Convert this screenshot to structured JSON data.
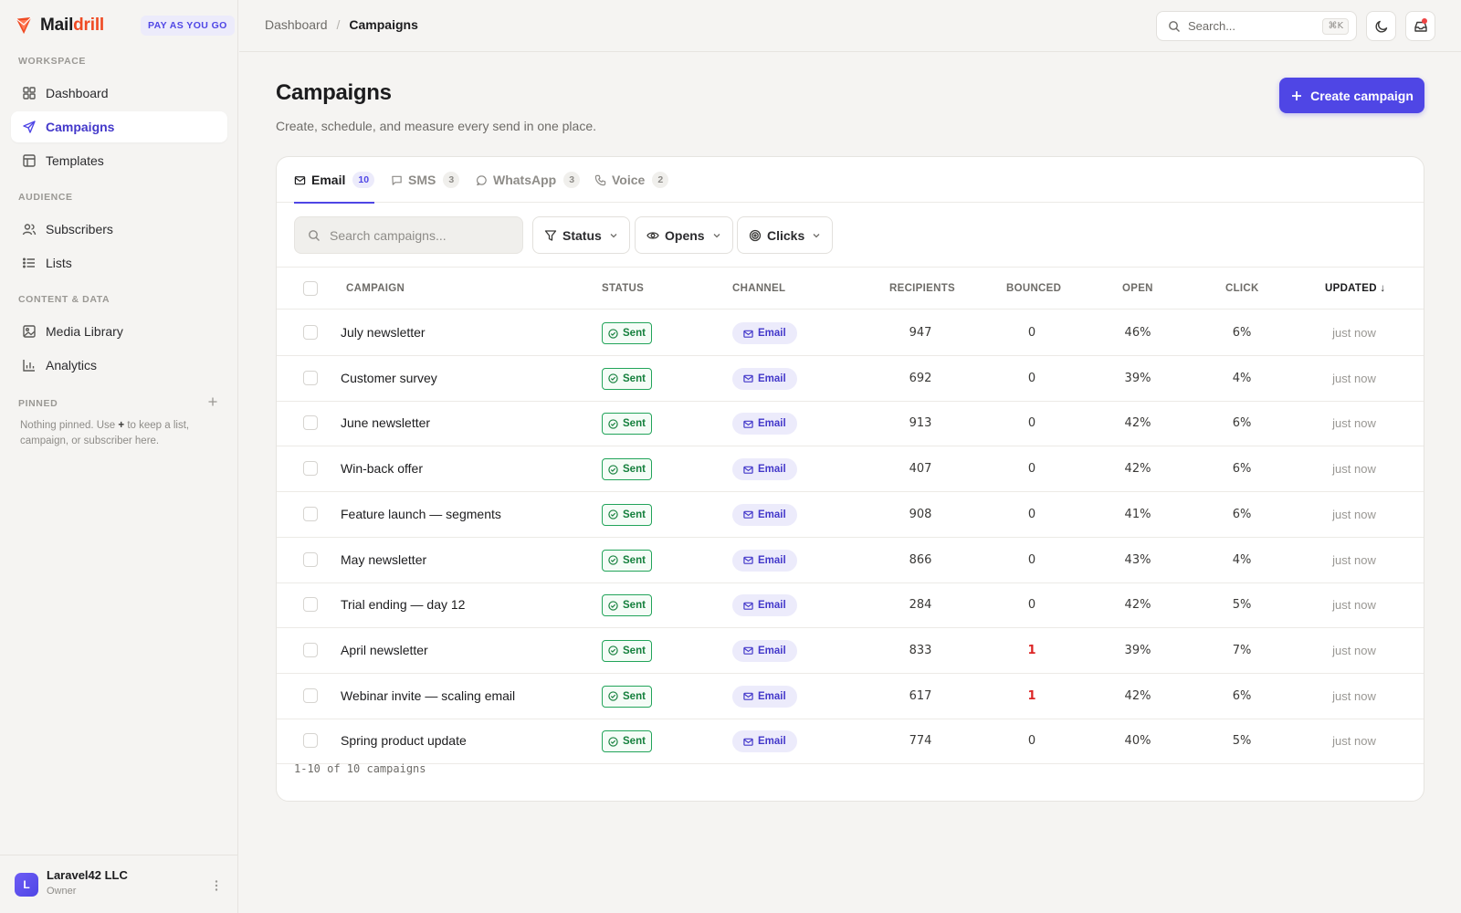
{
  "brand": {
    "name_part1": "Mail",
    "name_part2": "drill",
    "plan_badge": "PAY AS YOU GO",
    "accent": "#ef4a23"
  },
  "sidebar": {
    "sections": [
      "WORKSPACE",
      "AUDIENCE",
      "CONTENT & DATA",
      "PINNED"
    ],
    "items": [
      {
        "label": "Dashboard",
        "icon": "grid-icon"
      },
      {
        "label": "Campaigns",
        "icon": "send-icon",
        "active": true
      },
      {
        "label": "Templates",
        "icon": "layout-icon"
      },
      {
        "label": "Subscribers",
        "icon": "users-icon"
      },
      {
        "label": "Lists",
        "icon": "list-icon"
      },
      {
        "label": "Media Library",
        "icon": "image-icon"
      },
      {
        "label": "Analytics",
        "icon": "bar-chart-icon"
      }
    ],
    "pinned_note_1": "Nothing pinned. Use ",
    "pinned_note_plus": "+",
    "pinned_note_2": " to keep a list, campaign, or subscriber here.",
    "footer": {
      "avatar_letter": "L",
      "org_name": "Laravel42 LLC",
      "role": "Owner"
    }
  },
  "topbar": {
    "breadcrumb": [
      "Dashboard",
      "Campaigns"
    ],
    "breadcrumb_sep": "/",
    "search_placeholder": "Search...",
    "search_shortcut": "⌘K"
  },
  "page": {
    "title": "Campaigns",
    "subtitle": "Create, schedule, and measure every send in one place.",
    "create_button": "Create campaign",
    "primary_color": "#4f46e5"
  },
  "tabs": [
    {
      "label": "Email",
      "count": "10",
      "active": true,
      "icon": "mail-icon"
    },
    {
      "label": "SMS",
      "count": "3",
      "icon": "message-icon"
    },
    {
      "label": "WhatsApp",
      "count": "3",
      "icon": "chat-bubble-icon"
    },
    {
      "label": "Voice",
      "count": "2",
      "icon": "phone-icon"
    }
  ],
  "filters": {
    "search_placeholder": "Search campaigns...",
    "buttons": [
      {
        "label": "Status",
        "icon": "filter-icon"
      },
      {
        "label": "Opens",
        "icon": "eye-icon"
      },
      {
        "label": "Clicks",
        "icon": "target-icon"
      }
    ]
  },
  "table": {
    "columns": [
      "CAMPAIGN",
      "STATUS",
      "CHANNEL",
      "RECIPIENTS",
      "BOUNCED",
      "OPEN",
      "CLICK",
      "UPDATED ↓"
    ],
    "rows": [
      {
        "name": "July newsletter",
        "status": "Sent",
        "channel": "Email",
        "recipients": "947",
        "bounced": "0",
        "open": "46%",
        "click": "6%",
        "updated": "just now"
      },
      {
        "name": "Customer survey",
        "status": "Sent",
        "channel": "Email",
        "recipients": "692",
        "bounced": "0",
        "open": "39%",
        "click": "4%",
        "updated": "just now"
      },
      {
        "name": "June newsletter",
        "status": "Sent",
        "channel": "Email",
        "recipients": "913",
        "bounced": "0",
        "open": "42%",
        "click": "6%",
        "updated": "just now"
      },
      {
        "name": "Win-back offer",
        "status": "Sent",
        "channel": "Email",
        "recipients": "407",
        "bounced": "0",
        "open": "42%",
        "click": "6%",
        "updated": "just now"
      },
      {
        "name": "Feature launch — segments",
        "status": "Sent",
        "channel": "Email",
        "recipients": "908",
        "bounced": "0",
        "open": "41%",
        "click": "6%",
        "updated": "just now"
      },
      {
        "name": "May newsletter",
        "status": "Sent",
        "channel": "Email",
        "recipients": "866",
        "bounced": "0",
        "open": "43%",
        "click": "4%",
        "updated": "just now"
      },
      {
        "name": "Trial ending — day 12",
        "status": "Sent",
        "channel": "Email",
        "recipients": "284",
        "bounced": "0",
        "open": "42%",
        "click": "5%",
        "updated": "just now"
      },
      {
        "name": "April newsletter",
        "status": "Sent",
        "channel": "Email",
        "recipients": "833",
        "bounced": "1",
        "open": "39%",
        "click": "7%",
        "updated": "just now"
      },
      {
        "name": "Webinar invite — scaling email",
        "status": "Sent",
        "channel": "Email",
        "recipients": "617",
        "bounced": "1",
        "open": "42%",
        "click": "6%",
        "updated": "just now"
      },
      {
        "name": "Spring product update",
        "status": "Sent",
        "channel": "Email",
        "recipients": "774",
        "bounced": "0",
        "open": "40%",
        "click": "5%",
        "updated": "just now"
      }
    ],
    "footer": "1-10 of 10 campaigns"
  }
}
